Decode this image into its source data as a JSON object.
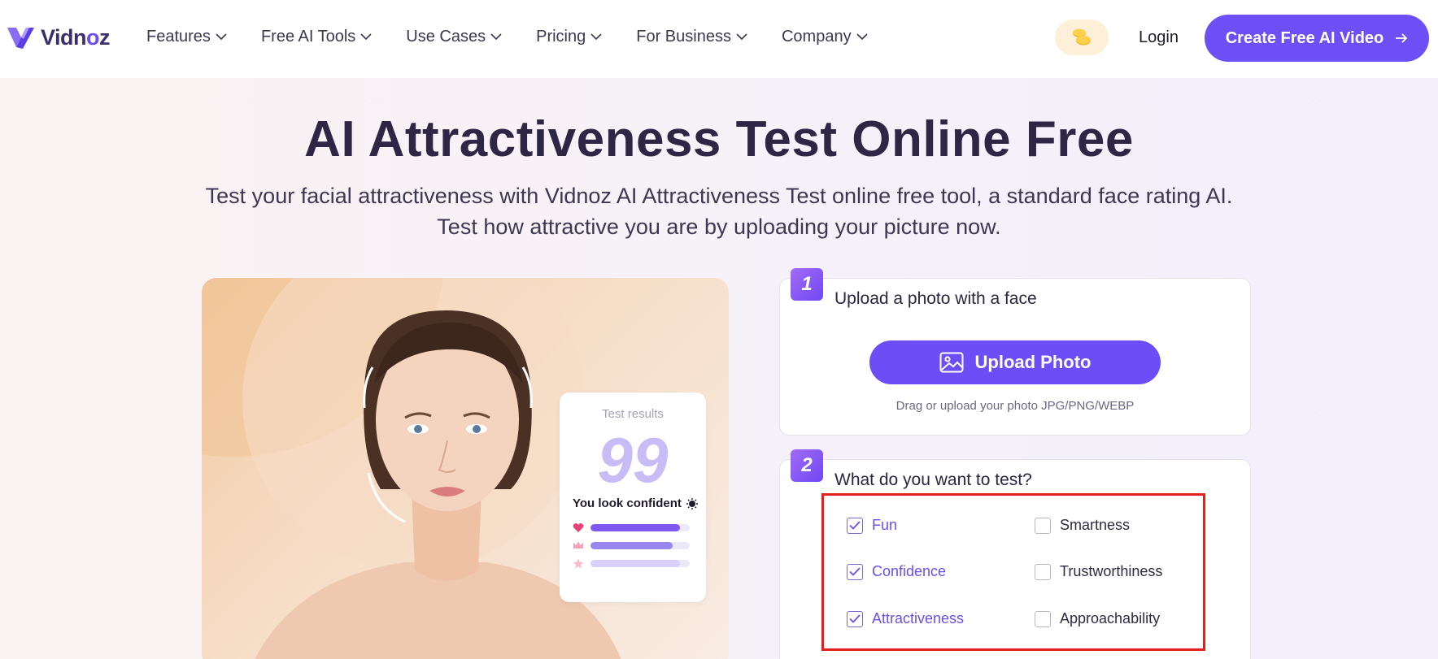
{
  "brand": {
    "name_prefix": "Vidn",
    "name_o": "o",
    "name_suffix": "z",
    "accent": "#6d4ff6"
  },
  "nav": {
    "items": [
      {
        "label": "Features"
      },
      {
        "label": "Free AI Tools"
      },
      {
        "label": "Use Cases"
      },
      {
        "label": "Pricing"
      },
      {
        "label": "For Business"
      },
      {
        "label": "Company"
      }
    ],
    "coin_icon": "coins-icon",
    "login_label": "Login",
    "cta_label": "Create Free AI Video",
    "cta_icon": "arrow-right-icon"
  },
  "hero": {
    "title": "AI Attractiveness Test Online Free",
    "subtitle_line1": "Test your facial attractiveness with Vidnoz AI Attractiveness Test online free tool, a standard face rating AI.",
    "subtitle_line2": "Test how attractive you are by uploading your picture now."
  },
  "preview": {
    "results_label": "Test results",
    "score": "99",
    "confidence_text": "You look confident",
    "bars": [
      {
        "icon": "heart-icon",
        "fill": 0.9,
        "color": "#7f58f2"
      },
      {
        "icon": "crown-icon",
        "fill": 0.83,
        "color": "#9a86f0"
      },
      {
        "icon": "star-icon",
        "fill": 0.9,
        "color": "#d8d0fa"
      }
    ]
  },
  "step1": {
    "number": "1",
    "title": "Upload a photo with a face",
    "button_label": "Upload Photo",
    "button_icon": "image-icon",
    "hint": "Drag or upload your photo JPG/PNG/WEBP"
  },
  "step2": {
    "number": "2",
    "title": "What do you want to test?",
    "options": [
      {
        "label": "Fun",
        "checked": true
      },
      {
        "label": "Smartness",
        "checked": false
      },
      {
        "label": "Confidence",
        "checked": true
      },
      {
        "label": "Trustworthiness",
        "checked": false
      },
      {
        "label": "Attractiveness",
        "checked": true
      },
      {
        "label": "Approachability",
        "checked": false
      }
    ]
  }
}
